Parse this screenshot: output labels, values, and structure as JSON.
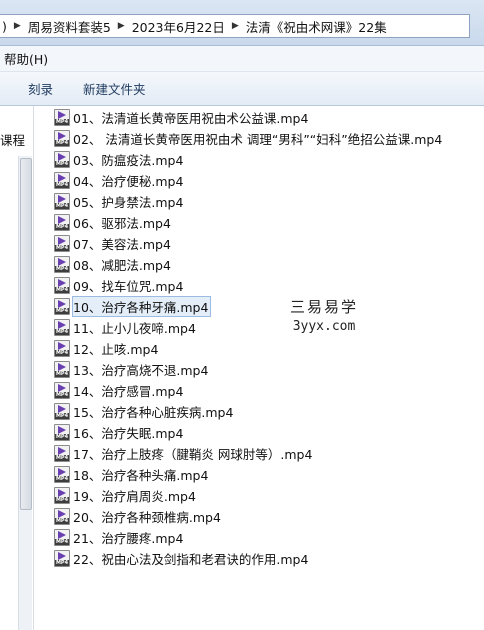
{
  "address": {
    "crumbs": [
      "周易资料套装5",
      "2023年6月22日",
      "法清《祝由术网课》22集"
    ],
    "partial_left": ")"
  },
  "menu": {
    "items": [
      "帮助(H)"
    ]
  },
  "toolbar": {
    "burn_label": "刻录",
    "new_folder_label": "新建文件夹"
  },
  "nav": {
    "visible_item": "课程"
  },
  "files": [
    "01、法清道长黄帝医用祝由术公益课.mp4",
    "02、 法清道长黄帝医用祝由术 调理“男科”“妇科”绝招公益课.mp4",
    "03、防瘟疫法.mp4",
    "04、治疗便秘.mp4",
    "05、护身禁法.mp4",
    "06、驱邪法.mp4",
    "07、美容法.mp4",
    "08、减肥法.mp4",
    "09、找车位咒.mp4",
    "10、治疗各种牙痛.mp4",
    "11、止小儿夜啼.mp4",
    "12、止咳.mp4",
    "13、治疗高烧不退.mp4",
    "14、治疗感冒.mp4",
    "15、治疗各种心脏疾病.mp4",
    "16、治疗失眠.mp4",
    "17、治疗上肢疼（腱鞘炎 网球肘等）.mp4",
    "18、治疗各种头痛.mp4",
    "19、治疗肩周炎.mp4",
    "20、治疗各种颈椎病.mp4",
    "21、治疗腰疼.mp4",
    "22、祝由心法及剑指和老君诀的作用.mp4"
  ],
  "selected_index": 9,
  "watermark": {
    "title": "三易易学",
    "url": "3yyx.com"
  }
}
